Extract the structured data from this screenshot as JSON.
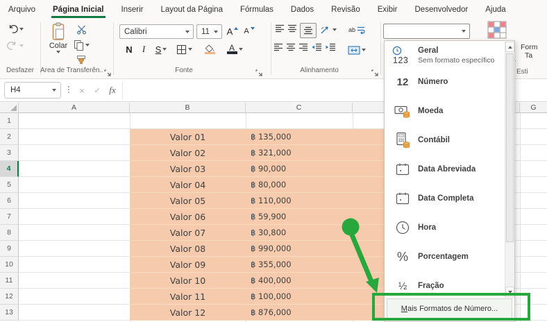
{
  "menubar": {
    "tabs": [
      {
        "label": "Arquivo",
        "active": false
      },
      {
        "label": "Página Inicial",
        "active": true
      },
      {
        "label": "Inserir",
        "active": false
      },
      {
        "label": "Layout da Página",
        "active": false
      },
      {
        "label": "Fórmulas",
        "active": false
      },
      {
        "label": "Dados",
        "active": false
      },
      {
        "label": "Revisão",
        "active": false
      },
      {
        "label": "Exibir",
        "active": false
      },
      {
        "label": "Desenvolvedor",
        "active": false
      },
      {
        "label": "Ajuda",
        "active": false
      }
    ]
  },
  "ribbon": {
    "groups": {
      "undo": "Desfazer",
      "clipboard": "Área de Transferên...",
      "font": "Fonte",
      "alignment": "Alinhamento",
      "styles": "Esti"
    },
    "paste_label": "Colar",
    "font_name": "Calibri",
    "font_size": "11",
    "bold": "N",
    "italic": "I",
    "underline": "S",
    "increase_font": "A",
    "decrease_font": "A",
    "wrap_text": "ab",
    "number_format_value": "",
    "styles_partial": {
      "line1": "Form",
      "line2": "Ta"
    }
  },
  "formula_bar": {
    "name_box": "H4",
    "cancel": "×",
    "enter": "✓",
    "fx": "fx",
    "formula": ""
  },
  "grid": {
    "col_headers": {
      "a": "A",
      "b": "B",
      "c": "C",
      "g": "G"
    },
    "row_numbers": [
      "1",
      "2",
      "3",
      "4",
      "5",
      "6",
      "7",
      "8",
      "9",
      "10",
      "11",
      "12",
      "13"
    ],
    "selected_row": "4",
    "cell_fill_color": "#F6CBAD",
    "currency_symbol": "฿",
    "rows": [
      {
        "label": "Valor 01",
        "value": "฿ 135,000"
      },
      {
        "label": "Valor 02",
        "value": "฿ 321,000"
      },
      {
        "label": "Valor 03",
        "value": "฿ 90,000"
      },
      {
        "label": "Valor 04",
        "value": "฿ 80,000"
      },
      {
        "label": "Valor 05",
        "value": "฿ 110,000"
      },
      {
        "label": "Valor 06",
        "value": "฿ 59,900"
      },
      {
        "label": "Valor 07",
        "value": "฿ 30,800"
      },
      {
        "label": "Valor 08",
        "value": "฿ 990,000"
      },
      {
        "label": "Valor 09",
        "value": "฿ 355,000"
      },
      {
        "label": "Valor 10",
        "value": "฿ 400,000"
      },
      {
        "label": "Valor 11",
        "value": "฿ 100,000"
      },
      {
        "label": "Valor 12",
        "value": "฿ 876,000"
      }
    ]
  },
  "format_menu": {
    "items": [
      {
        "label": "Geral",
        "subtitle": "Sem formato específico",
        "glyph": "123"
      },
      {
        "label": "Número",
        "glyph": "12"
      },
      {
        "label": "Moeda"
      },
      {
        "label": "Contábil"
      },
      {
        "label": "Data Abreviada"
      },
      {
        "label": "Data Completa"
      },
      {
        "label": "Hora"
      },
      {
        "label": "Porcentagem",
        "glyph": "%"
      },
      {
        "label": "Fração",
        "glyph": "½"
      }
    ],
    "more": {
      "accel": "M",
      "rest": "ais Formatos de Número..."
    }
  },
  "annotation": {
    "color": "#28A83C"
  },
  "colors": {
    "accent_green": "#107C41",
    "cell_fill": "#F6CBAD"
  }
}
